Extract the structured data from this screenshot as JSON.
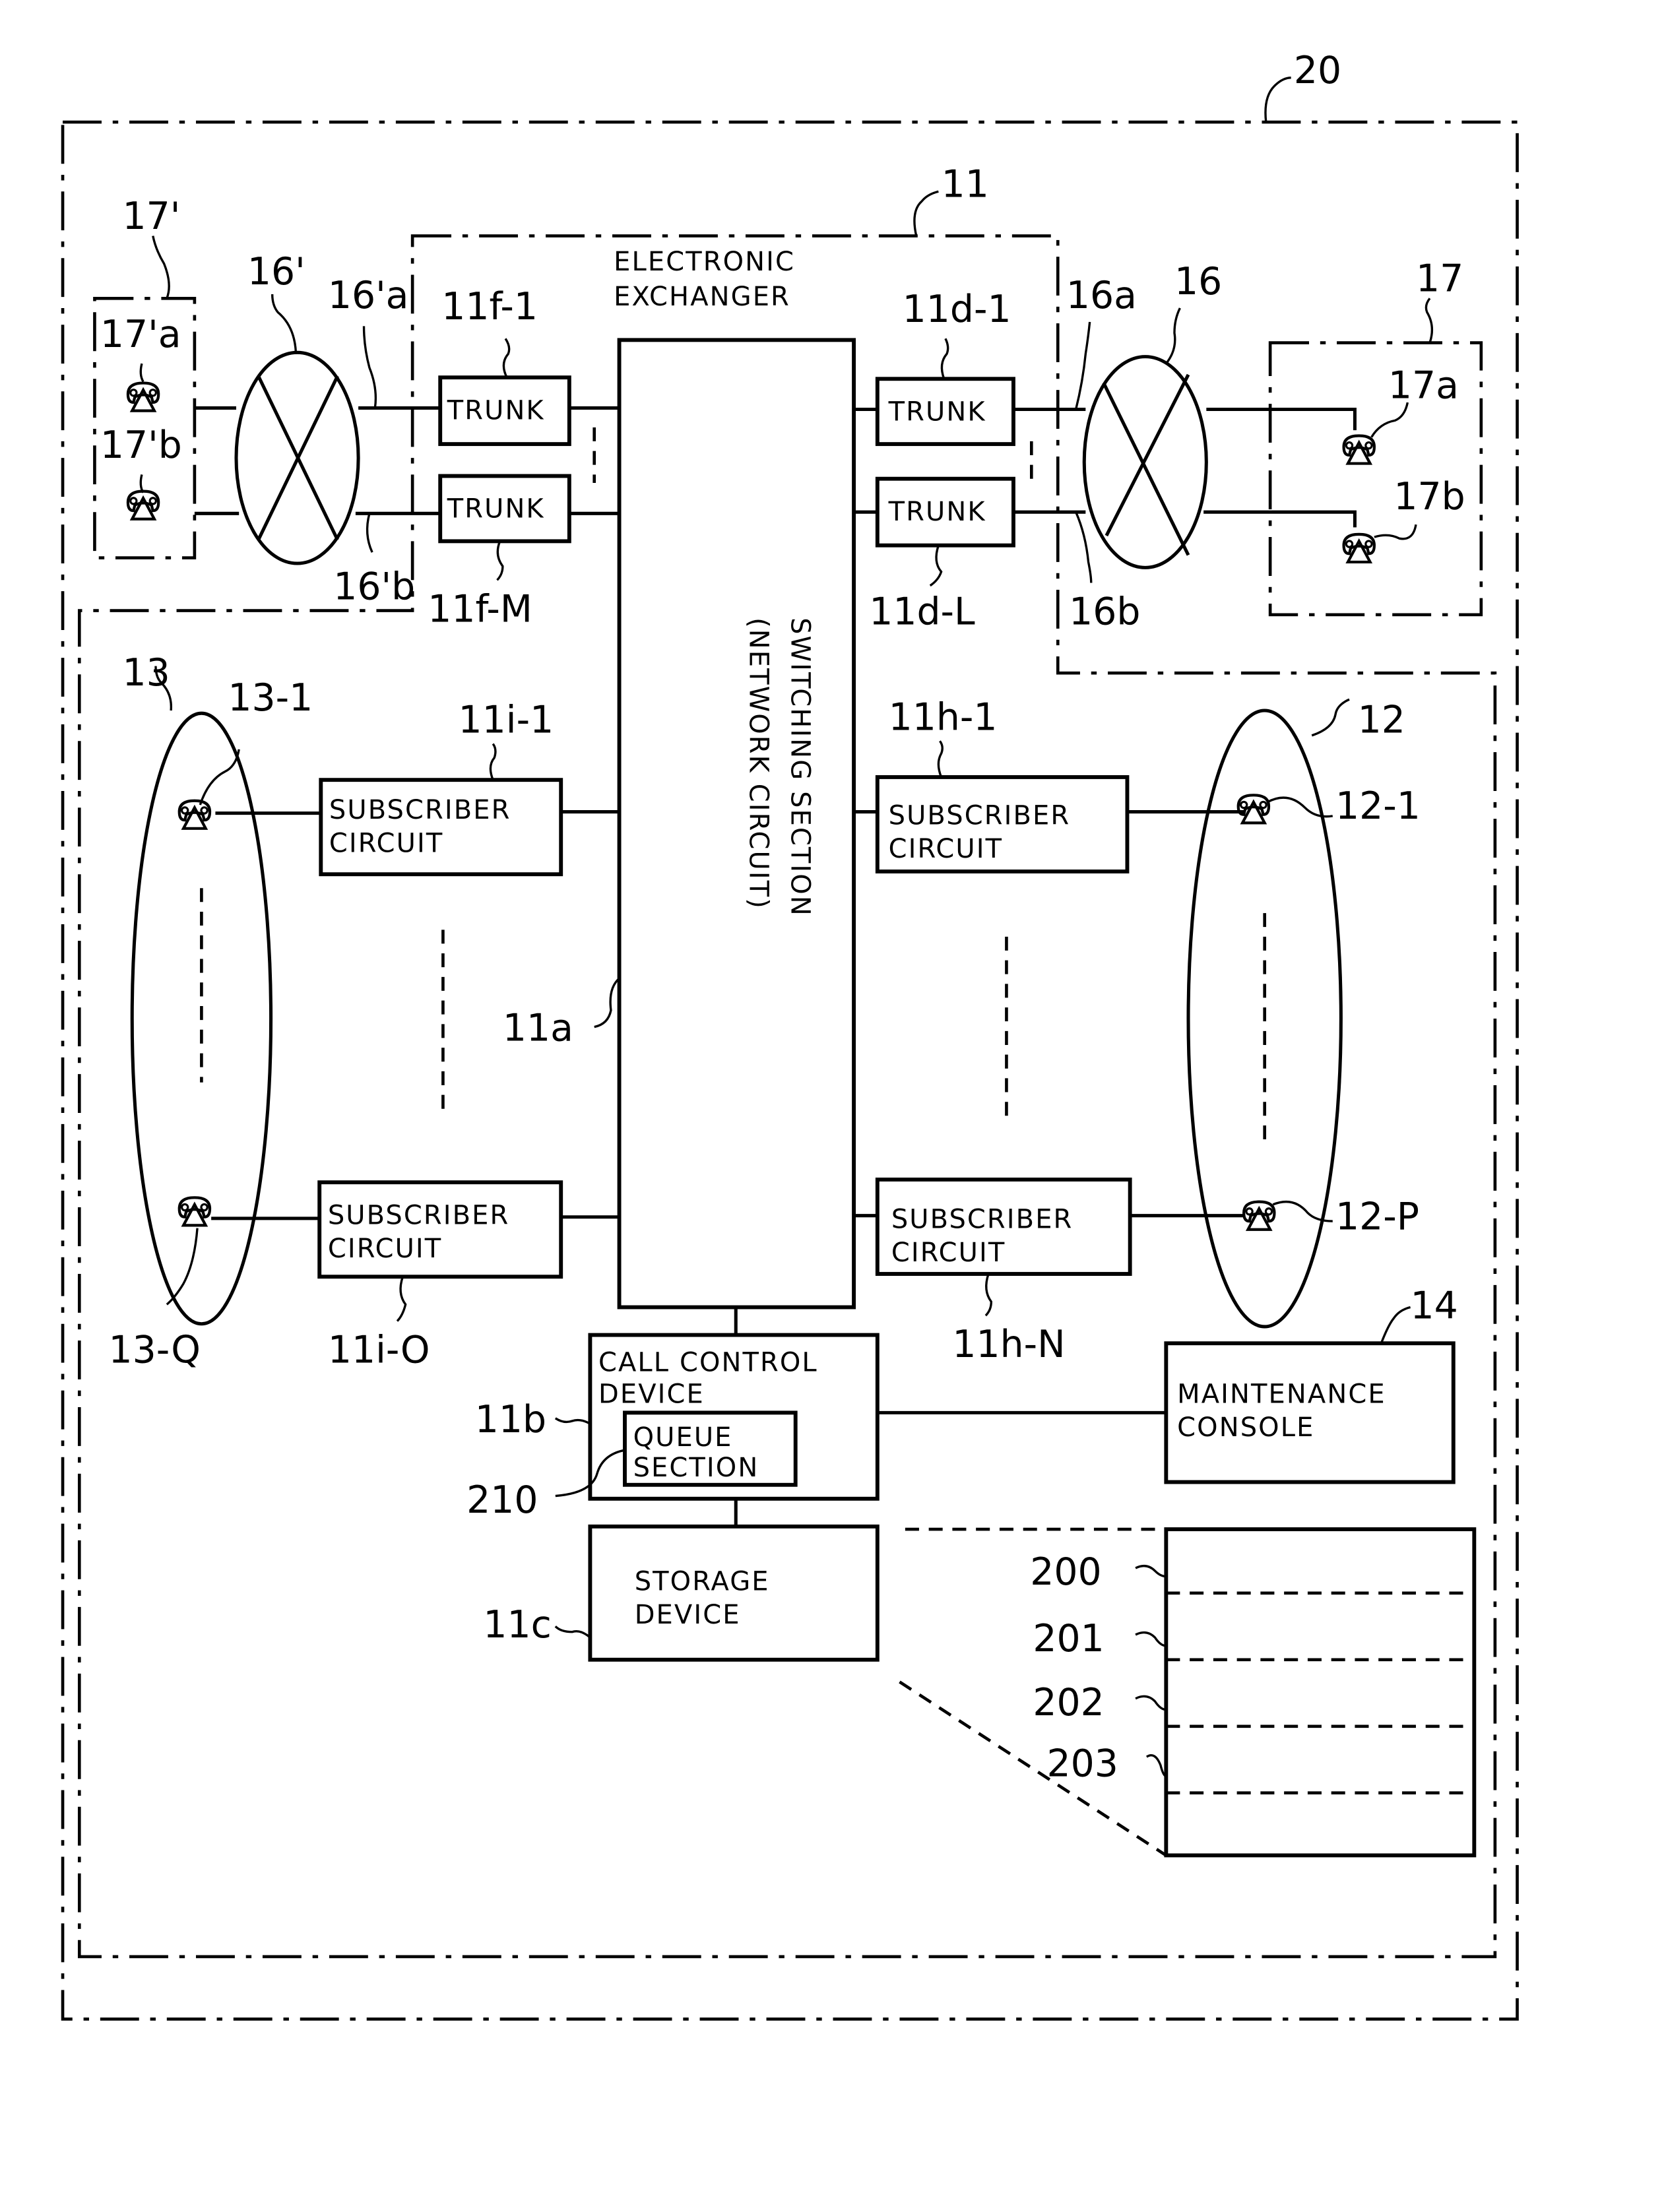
{
  "figure": {
    "system_ref": "20",
    "exchanger": {
      "ref": "11",
      "title_line1": "ELECTRONIC",
      "title_line2": "EXCHANGER"
    },
    "switching": {
      "ref": "11a",
      "line1": "SWITCHING SECTION",
      "line2": "(NETWORK CIRCUIT)"
    },
    "trunks_left": [
      {
        "ref": "11f-1",
        "label": "TRUNK"
      },
      {
        "ref": "11f-M",
        "label": "TRUNK"
      }
    ],
    "trunks_right": [
      {
        "ref": "11d-1",
        "label": "TRUNK"
      },
      {
        "ref": "11d-L",
        "label": "TRUNK"
      }
    ],
    "networks": {
      "left": {
        "ref": "16'",
        "line_a": "16'a",
        "line_b": "16'b"
      },
      "right": {
        "ref": "16",
        "line_a": "16a",
        "line_b": "16b"
      }
    },
    "remote_groups": {
      "left": {
        "ref": "17'",
        "phone_a": "17'a",
        "phone_b": "17'b"
      },
      "right": {
        "ref": "17",
        "phone_a": "17a",
        "phone_b": "17b"
      }
    },
    "subscriber_circuits_left": [
      {
        "ref": "11i-1",
        "line1": "SUBSCRIBER",
        "line2": "CIRCUIT"
      },
      {
        "ref": "11i-O",
        "line1": "SUBSCRIBER",
        "line2": "CIRCUIT"
      }
    ],
    "subscriber_circuits_right": [
      {
        "ref": "11h-1",
        "line1": "SUBSCRIBER",
        "line2": "CIRCUIT"
      },
      {
        "ref": "11h-N",
        "line1": "SUBSCRIBER",
        "line2": "CIRCUIT"
      }
    ],
    "subscriber_groups": {
      "left": {
        "ref": "13",
        "first": "13-1",
        "last": "13-Q"
      },
      "right": {
        "ref": "12",
        "first": "12-1",
        "last": "12-P"
      }
    },
    "call_control": {
      "ref": "11b",
      "line1": "CALL CONTROL",
      "line2": "DEVICE"
    },
    "queue": {
      "ref": "210",
      "line1": "QUEUE",
      "line2": "SECTION"
    },
    "storage": {
      "ref": "11c",
      "line1": "STORAGE",
      "line2": "DEVICE"
    },
    "maintenance": {
      "ref": "14",
      "line1": "MAINTENANCE",
      "line2": "CONSOLE"
    },
    "storage_table": {
      "rows": [
        "200",
        "201",
        "202",
        "203"
      ]
    }
  }
}
